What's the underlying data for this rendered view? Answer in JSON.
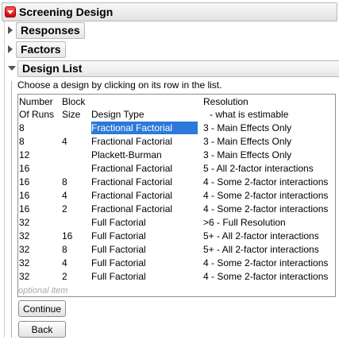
{
  "header": {
    "title": "Screening Design"
  },
  "sections": {
    "responses": "Responses",
    "factors": "Factors",
    "design_list": "Design List"
  },
  "instruction": "Choose a design by clicking on its row in the list.",
  "table": {
    "headers": {
      "runs_line1": "Number",
      "runs_line2": "Of Runs",
      "block_line1": "Block",
      "block_line2": "Size",
      "type": "Design Type",
      "res_line1": "Resolution",
      "res_line2": "- what is estimable"
    },
    "rows": [
      {
        "runs": "8",
        "block": "",
        "type": "Fractional Factorial",
        "resolution": "3 - Main Effects Only",
        "selected": true
      },
      {
        "runs": "8",
        "block": "4",
        "type": "Fractional Factorial",
        "resolution": "3 - Main Effects Only"
      },
      {
        "runs": "12",
        "block": "",
        "type": "Plackett-Burman",
        "resolution": "3 - Main Effects Only"
      },
      {
        "runs": "16",
        "block": "",
        "type": "Fractional Factorial",
        "resolution": "5 - All 2-factor interactions"
      },
      {
        "runs": "16",
        "block": "8",
        "type": "Fractional Factorial",
        "resolution": "4 - Some 2-factor interactions"
      },
      {
        "runs": "16",
        "block": "4",
        "type": "Fractional Factorial",
        "resolution": "4 - Some 2-factor interactions"
      },
      {
        "runs": "16",
        "block": "2",
        "type": "Fractional Factorial",
        "resolution": "4 - Some 2-factor interactions"
      },
      {
        "runs": "32",
        "block": "",
        "type": "Full Factorial",
        "resolution": ">6 - Full Resolution"
      },
      {
        "runs": "32",
        "block": "16",
        "type": "Full Factorial",
        "resolution": "5+ - All 2-factor interactions"
      },
      {
        "runs": "32",
        "block": "8",
        "type": "Full Factorial",
        "resolution": "5+ - All 2-factor interactions"
      },
      {
        "runs": "32",
        "block": "4",
        "type": "Full Factorial",
        "resolution": "4 - Some 2-factor interactions"
      },
      {
        "runs": "32",
        "block": "2",
        "type": "Full Factorial",
        "resolution": "4 - Some 2-factor interactions"
      }
    ],
    "optional_label": "optional item"
  },
  "buttons": {
    "continue": "Continue",
    "back": "Back"
  },
  "colors": {
    "selection": "#2c79d9",
    "red_button": "#d40000"
  }
}
